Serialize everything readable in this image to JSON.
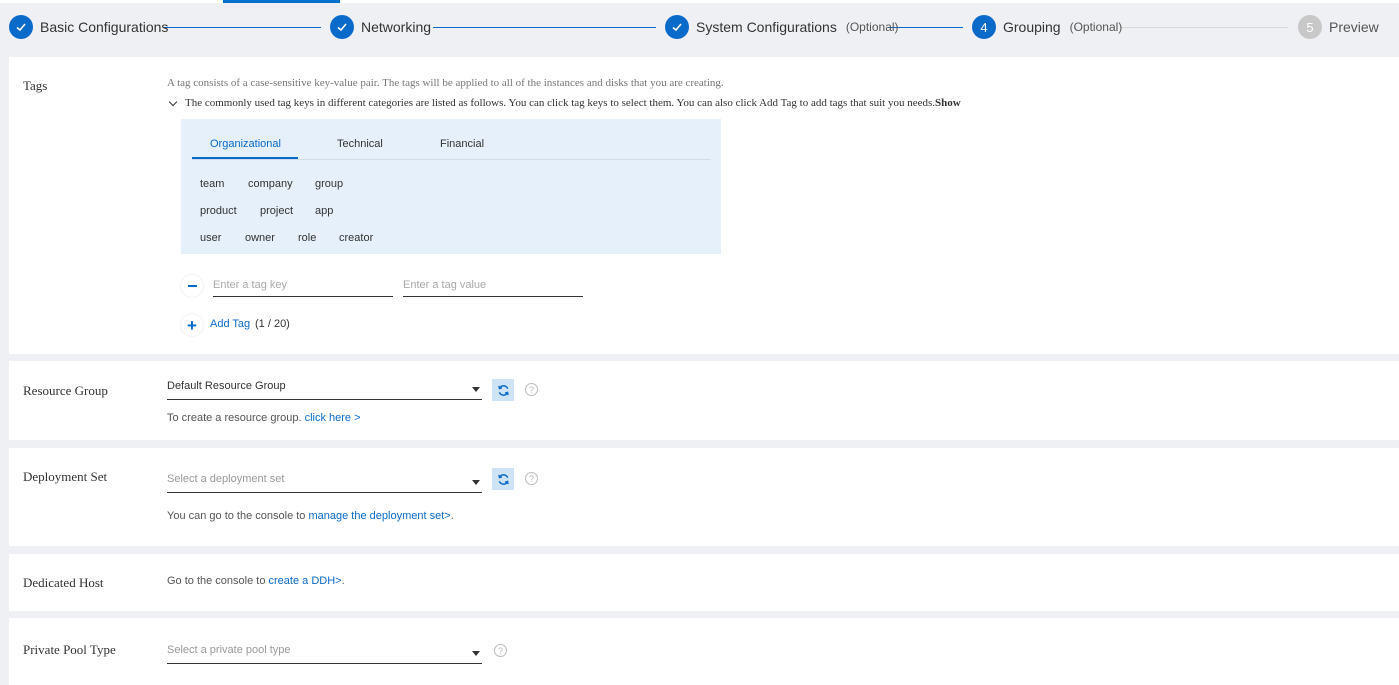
{
  "steps": [
    {
      "label": "Basic Configurations",
      "state": "done"
    },
    {
      "label": "Networking",
      "state": "done"
    },
    {
      "label": "System Configurations",
      "optional": "(Optional)",
      "state": "done"
    },
    {
      "label": "Grouping",
      "number": "4",
      "optional": "(Optional)",
      "state": "active"
    },
    {
      "label": "Preview",
      "number": "5",
      "state": "future"
    }
  ],
  "tags": {
    "label": "Tags",
    "description": "A tag consists of a case-sensitive key-value pair. The tags will be applied to all of the instances and disks that you are creating.",
    "hint": "The commonly used tag keys in different categories are listed as follows. You can click tag keys to select them. You can also click Add Tag to add tags that suit you needs.",
    "hint_toggle": "Show",
    "tabs": [
      "Organizational",
      "Technical",
      "Financial"
    ],
    "keys_row1": [
      "team",
      "company",
      "group"
    ],
    "keys_row2": [
      "product",
      "project",
      "app"
    ],
    "keys_row3": [
      "user",
      "owner",
      "role",
      "creator"
    ],
    "key_placeholder": "Enter a tag key",
    "value_placeholder": "Enter a tag value",
    "add_tag": "Add Tag",
    "add_count": "(1 / 20)"
  },
  "resource_group": {
    "label": "Resource Group",
    "value": "Default Resource Group",
    "note": "To create a resource group.",
    "link": "click here >"
  },
  "deployment_set": {
    "label": "Deployment Set",
    "placeholder": "Select a deployment set",
    "note": "You can go to the console to",
    "link": "manage the deployment set>",
    "suffix": "."
  },
  "dedicated_host": {
    "label": "Dedicated Host",
    "note": "Go to the console to",
    "link": "create a DDH>",
    "suffix": "."
  },
  "private_pool": {
    "label": "Private Pool Type",
    "placeholder": "Select a private pool type"
  },
  "icons": {
    "help": "?"
  }
}
